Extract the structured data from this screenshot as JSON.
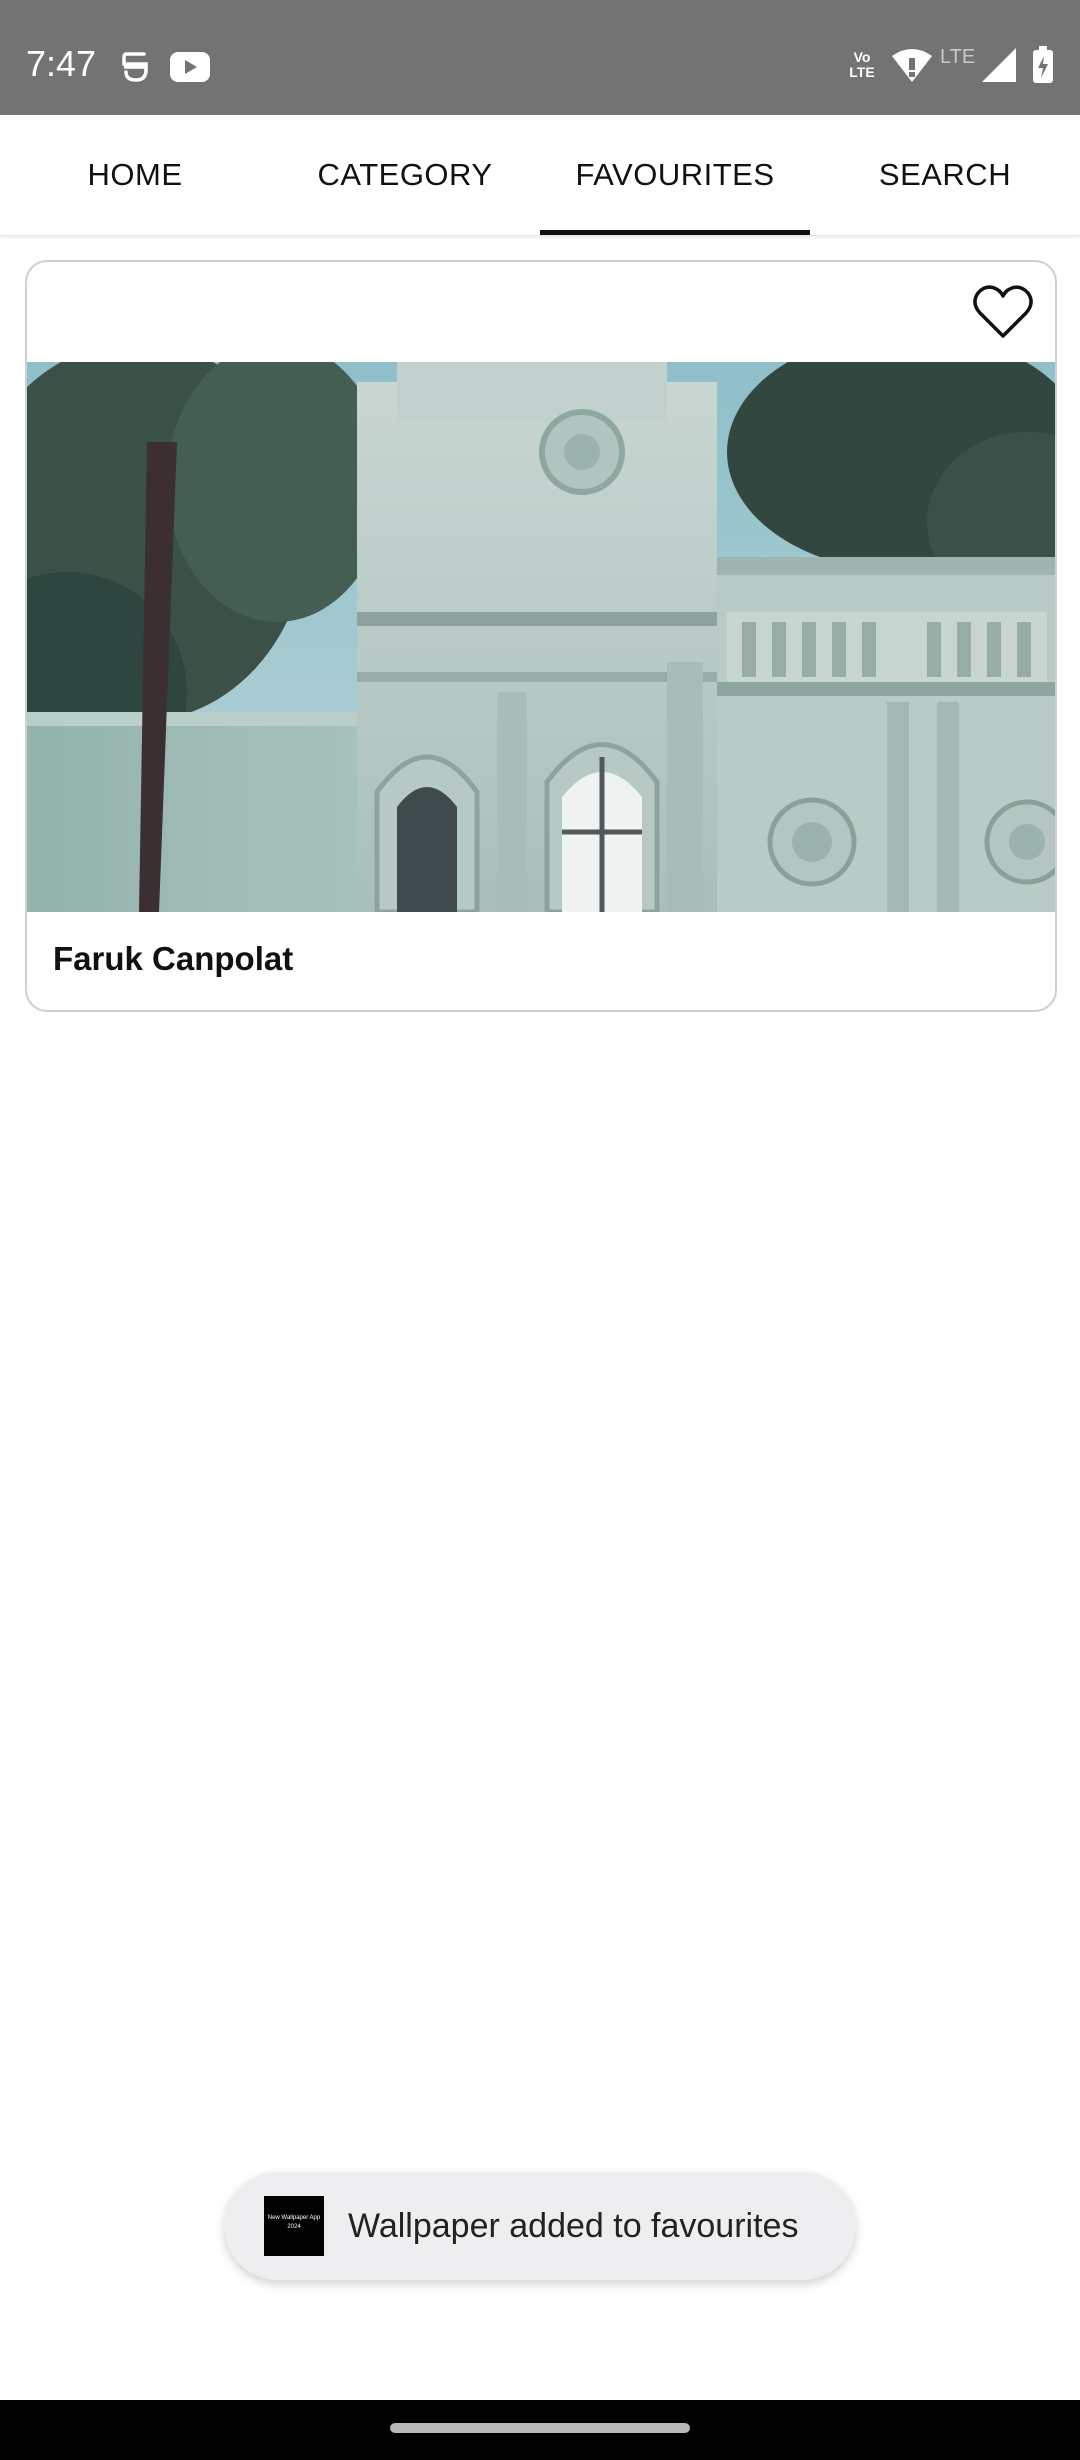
{
  "status_bar": {
    "time": "7:47",
    "icons": [
      "vpn-key-icon",
      "youtube-icon",
      "volte-icon",
      "wifi-icon",
      "lte-icon",
      "signal-icon",
      "battery-icon"
    ],
    "volte_label": "Vo LTE",
    "lte_label": "LTE"
  },
  "tabs": [
    {
      "label": "HOME",
      "selected": false
    },
    {
      "label": "CATEGORY",
      "selected": false
    },
    {
      "label": "FAVOURITES",
      "selected": true
    },
    {
      "label": "SEARCH",
      "selected": false
    }
  ],
  "favourites": {
    "items": [
      {
        "title": "Faruk Canpolat",
        "favourite_icon": "heart-outline-icon",
        "image": "ornate-palace-gate-with-trees"
      }
    ]
  },
  "toast": {
    "logo_text": "New Wallpaper App 2024",
    "message": "Wallpaper added to favourites"
  },
  "colors": {
    "status_bar": "#737373",
    "accent": "#111111",
    "toast_bg": "#eeeef0",
    "nav_bar": "#000000"
  }
}
